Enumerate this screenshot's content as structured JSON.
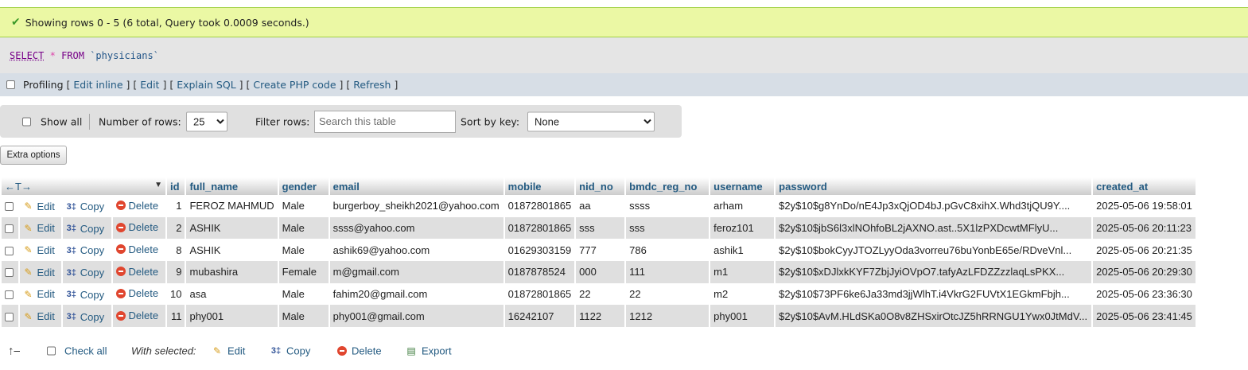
{
  "message": "Showing rows 0 - 5 (6 total, Query took 0.0009 seconds.)",
  "sql": {
    "select": "SELECT",
    "star": "*",
    "from": "FROM",
    "table": "`physicians`"
  },
  "profiling": {
    "label": "Profiling",
    "links": [
      "Edit inline",
      "Edit",
      "Explain SQL",
      "Create PHP code",
      "Refresh"
    ]
  },
  "nav": {
    "show_all": "Show all",
    "rows_label": "Number of rows:",
    "rows_value": "25",
    "filter_label": "Filter rows:",
    "filter_placeholder": "Search this table",
    "sort_label": "Sort by key:",
    "sort_value": "None"
  },
  "extra_options": "Extra options",
  "actions": {
    "edit": "Edit",
    "copy": "Copy",
    "delete": "Delete"
  },
  "table": {
    "columns": [
      "id",
      "full_name",
      "gender",
      "email",
      "mobile",
      "nid_no",
      "bmdc_reg_no",
      "username",
      "password",
      "created_at"
    ],
    "rows": [
      [
        "1",
        "FEROZ MAHMUD",
        "Male",
        "burgerboy_sheikh2021@yahoo.com",
        "01872801865",
        "aa",
        "ssss",
        "arham",
        "$2y$10$g8YnDo/nE4Jp3xQjOD4bJ.pGvC8xihX.Whd3tjQU9Y....",
        "2025-05-06 19:58:01"
      ],
      [
        "2",
        "ASHIK",
        "Male",
        "ssss@yahoo.com",
        "01872801865",
        "sss",
        "sss",
        "feroz101",
        "$2y$10$jbS6l3xlNOhfoBL2jAXNO.ast..5X1lzPXDcwtMFlyU...",
        "2025-05-06 20:11:23"
      ],
      [
        "8",
        "ASHIK",
        "Male",
        "ashik69@yahoo.com",
        "01629303159",
        "777",
        "786",
        "ashik1",
        "$2y$10$bokCyyJTOZLyyOda3vorreu76buYonbE65e/RDveVnl...",
        "2025-05-06 20:21:35"
      ],
      [
        "9",
        "mubashira",
        "Female",
        "m@gmail.com",
        "0187878524",
        "000",
        "111",
        "m1",
        "$2y$10$xDJlxkKYF7ZbjJyiOVpO7.tafyAzLFDZZzzlaqLsPKX...",
        "2025-05-06 20:29:30"
      ],
      [
        "10",
        "asa",
        "Male",
        "fahim20@gmail.com",
        "01872801865",
        "22",
        "22",
        "m2",
        "$2y$10$73PF6ke6Ja33md3jjWlhT.i4VkrG2FUVtX1EGkmFbjh...",
        "2025-05-06 23:36:30"
      ],
      [
        "11",
        "phy001",
        "Male",
        "phy001@gmail.com",
        "16242107",
        "1122",
        "1212",
        "phy001",
        "$2y$10$AvM.HLdSKa0O8v8ZHSxirOtcJZ5hRRNGU1Ywx0JtMdV...",
        "2025-05-06 23:41:45"
      ]
    ]
  },
  "bottom": {
    "check_all": "Check all",
    "with_selected": "With selected:",
    "edit": "Edit",
    "copy": "Copy",
    "delete": "Delete",
    "export": "Export"
  },
  "colors": {
    "success_bg": "#ebf8a4",
    "link": "#235a81",
    "row_alt": "#dfdfdf"
  }
}
